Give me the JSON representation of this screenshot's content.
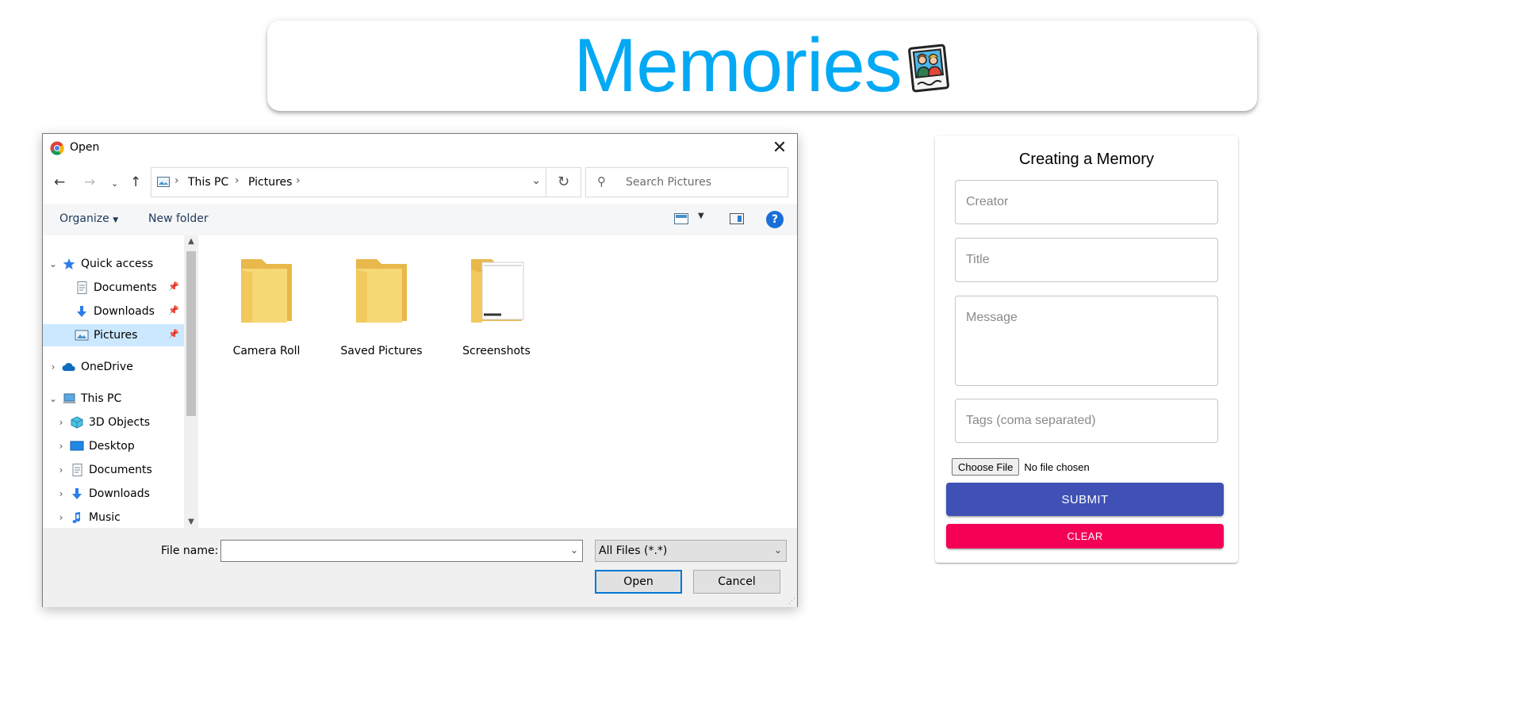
{
  "app": {
    "title": "Memories",
    "logo_icon": "photo-memories-icon",
    "accent_color": "#03a9f4"
  },
  "form": {
    "heading": "Creating a Memory",
    "creator_placeholder": "Creator",
    "title_placeholder": "Title",
    "message_placeholder": "Message",
    "tags_placeholder": "Tags (coma separated)",
    "file_button": "Choose File",
    "file_status": "No file chosen",
    "submit_label": "SUBMIT",
    "clear_label": "CLEAR",
    "submit_color": "#3f51b5",
    "clear_color": "#f50057"
  },
  "dialog": {
    "title": "Open",
    "address": [
      "This PC",
      "Pictures"
    ],
    "search_placeholder": "Search Pictures",
    "organize_label": "Organize",
    "new_folder_label": "New folder",
    "help_label": "?",
    "tree": [
      {
        "label": "Quick access",
        "icon": "star-icon",
        "expanded": true
      },
      {
        "label": "Documents",
        "icon": "document-icon",
        "pinned": true
      },
      {
        "label": "Downloads",
        "icon": "download-icon",
        "pinned": true
      },
      {
        "label": "Pictures",
        "icon": "pictures-icon",
        "pinned": true,
        "selected": true
      },
      {
        "label": "OneDrive",
        "icon": "cloud-icon",
        "expanded": false
      },
      {
        "label": "This PC",
        "icon": "computer-icon",
        "expanded": true
      },
      {
        "label": "3D Objects",
        "icon": "cube-icon"
      },
      {
        "label": "Desktop",
        "icon": "desktop-icon"
      },
      {
        "label": "Documents",
        "icon": "document-icon"
      },
      {
        "label": "Downloads",
        "icon": "download-icon"
      },
      {
        "label": "Music",
        "icon": "music-icon"
      }
    ],
    "folders": [
      "Camera Roll",
      "Saved Pictures",
      "Screenshots"
    ],
    "file_name_label": "File name:",
    "file_name_value": "",
    "file_type": "All Files (*.*)",
    "open_label": "Open",
    "cancel_label": "Cancel"
  }
}
